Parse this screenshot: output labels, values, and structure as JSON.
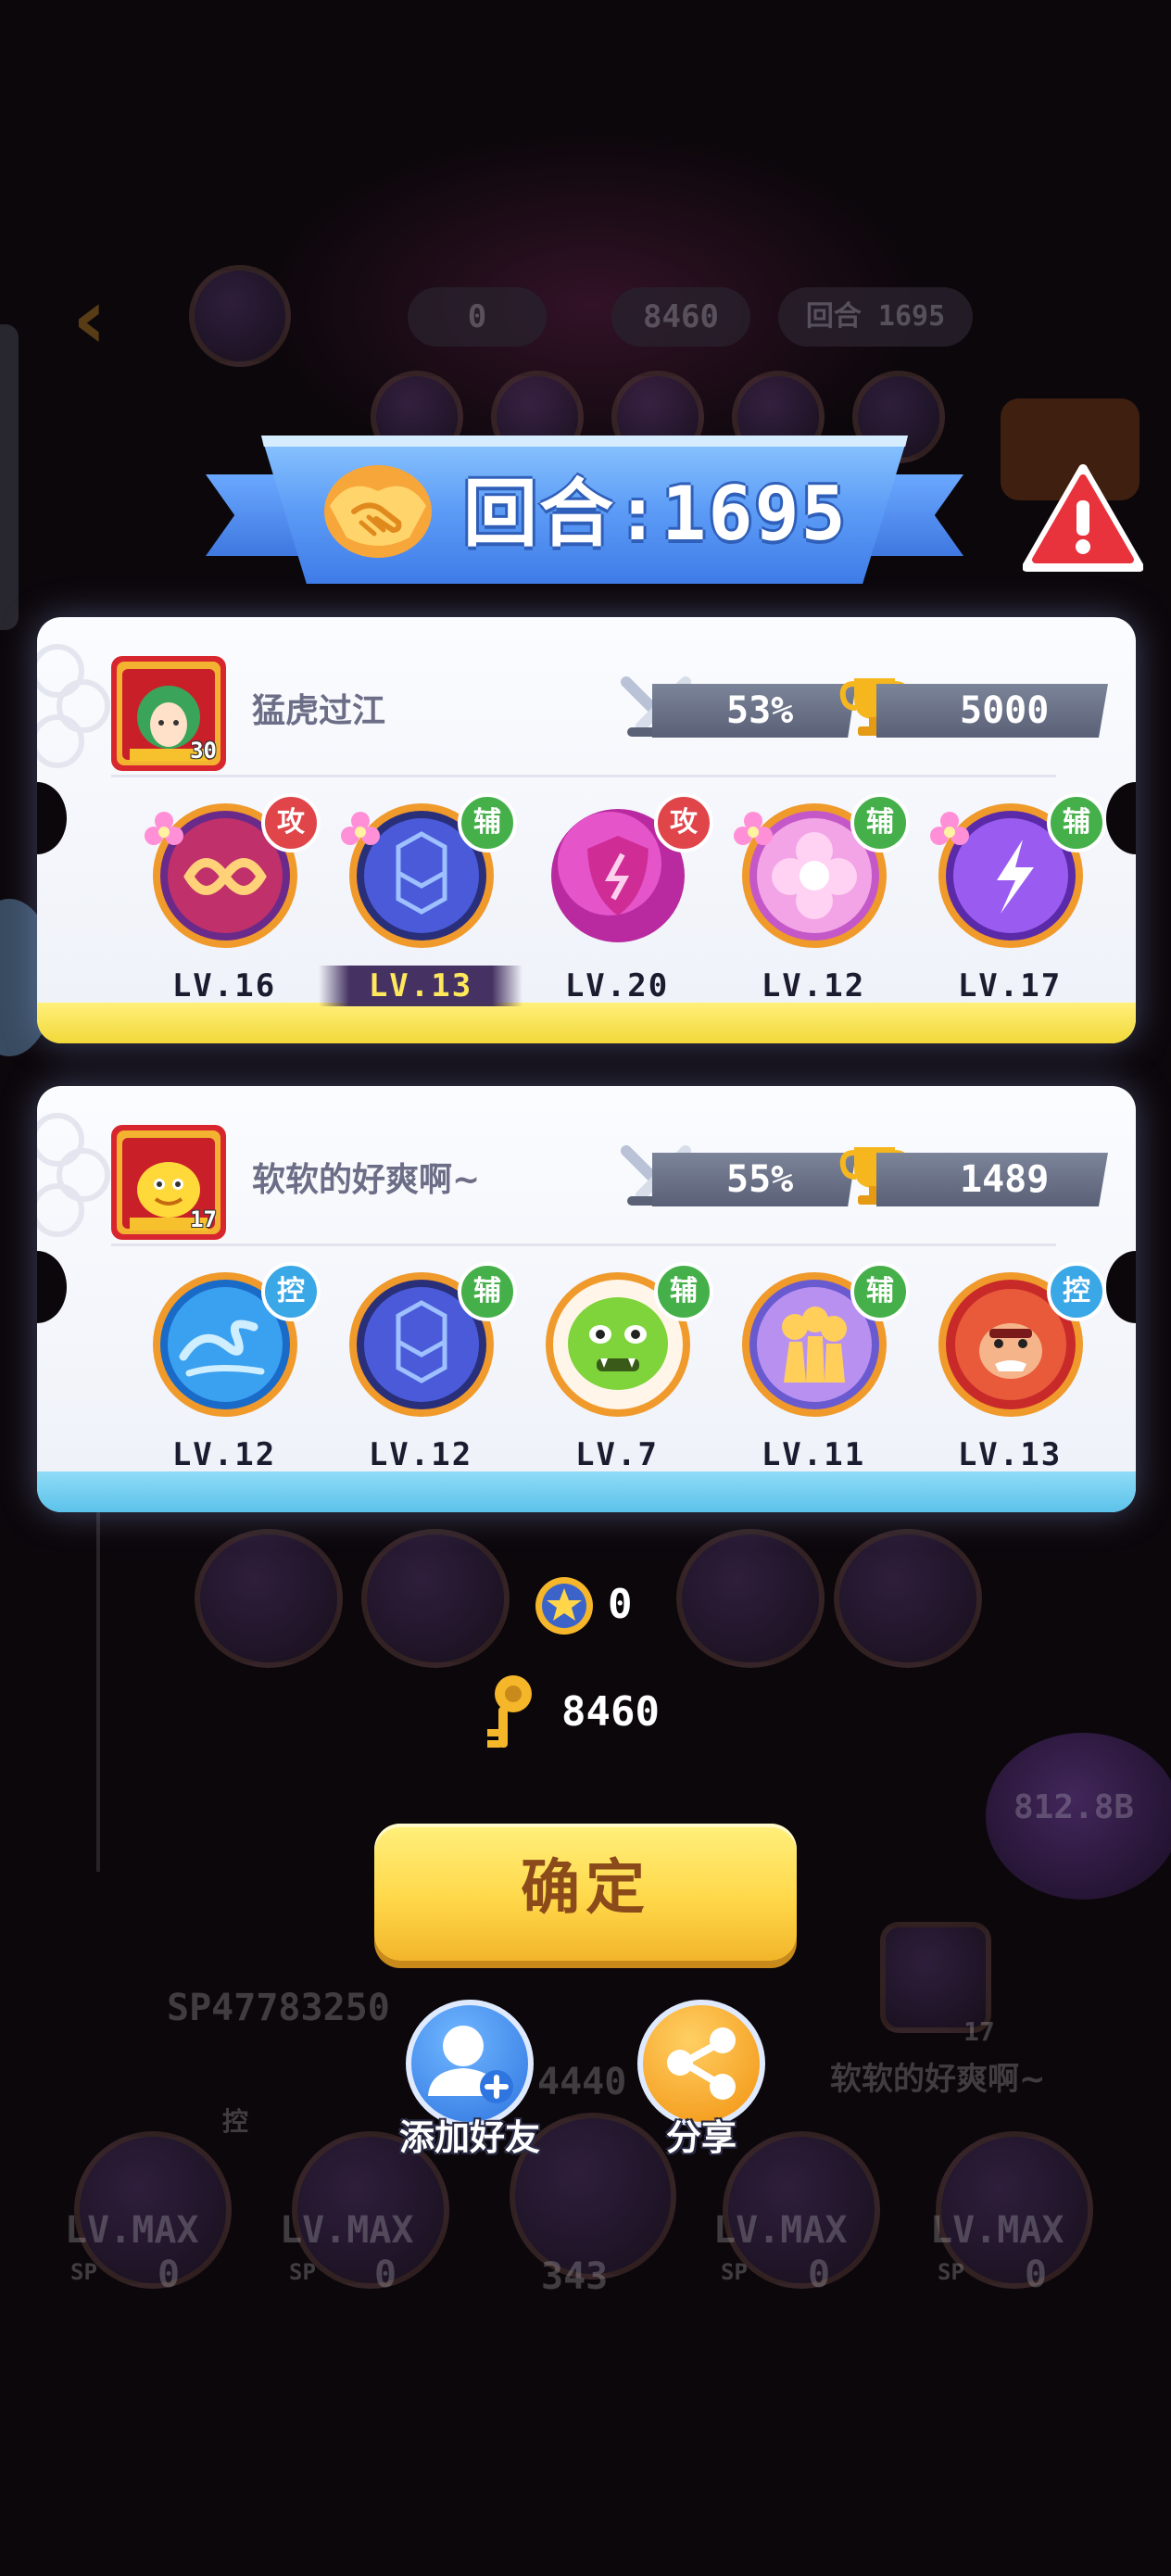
{
  "background": {
    "top_coin_value": "0",
    "top_key_value": "8460",
    "top_round_label": "回合",
    "top_round_value": "1695",
    "player_id": "SP47783250",
    "center_number": "4440",
    "opponent_name": "软软的好爽啊~",
    "opponent_level": "17",
    "big_orb_value": "812.8B",
    "slot_levels": [
      "LV.MAX",
      "LV.MAX",
      "LV.MAX",
      "LV.MAX"
    ],
    "slot_sp_values": [
      "0",
      "0",
      "0",
      "0"
    ],
    "sp_label": "SP",
    "center_power": "343",
    "control_badge": "控"
  },
  "banner": {
    "title": "回合:1695",
    "icon": "handshake-icon"
  },
  "warning": {
    "icon": "warning-icon"
  },
  "players": [
    {
      "name": "猛虎过江",
      "avatar_level": "30",
      "win_rate": "53%",
      "trophies": "5000",
      "accent_color": "#f2d83a",
      "pets": [
        {
          "role": "攻",
          "role_type": "attack",
          "level": "LV.16",
          "icon": "infinity-orb-icon",
          "highlight": false
        },
        {
          "role": "辅",
          "role_type": "assist",
          "level": "LV.13",
          "icon": "hexagon-orb-icon",
          "highlight": true
        },
        {
          "role": "攻",
          "role_type": "attack",
          "level": "LV.20",
          "icon": "shield-orb-icon",
          "highlight": false
        },
        {
          "role": "辅",
          "role_type": "assist",
          "level": "LV.12",
          "icon": "flower-orb-icon",
          "highlight": false
        },
        {
          "role": "辅",
          "role_type": "assist",
          "level": "LV.17",
          "icon": "lightning-orb-icon",
          "highlight": false
        }
      ]
    },
    {
      "name": "软软的好爽啊~",
      "avatar_level": "17",
      "win_rate": "55%",
      "trophies": "1489",
      "accent_color": "#5cc2ea",
      "pets": [
        {
          "role": "控",
          "role_type": "control",
          "level": "LV.12",
          "icon": "wave-orb-icon",
          "highlight": false
        },
        {
          "role": "辅",
          "role_type": "assist",
          "level": "LV.12",
          "icon": "hexagon-orb-icon",
          "highlight": false
        },
        {
          "role": "辅",
          "role_type": "assist",
          "level": "LV.7",
          "icon": "goblin-pet-icon",
          "highlight": false
        },
        {
          "role": "辅",
          "role_type": "assist",
          "level": "LV.11",
          "icon": "shadow-orb-icon",
          "highlight": false
        },
        {
          "role": "控",
          "role_type": "control",
          "level": "LV.13",
          "icon": "gorilla-pet-icon",
          "highlight": false
        }
      ]
    }
  ],
  "rewards": {
    "coin_value": "0",
    "key_value": "8460"
  },
  "buttons": {
    "confirm": "确定",
    "add_friend": "添加好友",
    "share": "分享"
  }
}
